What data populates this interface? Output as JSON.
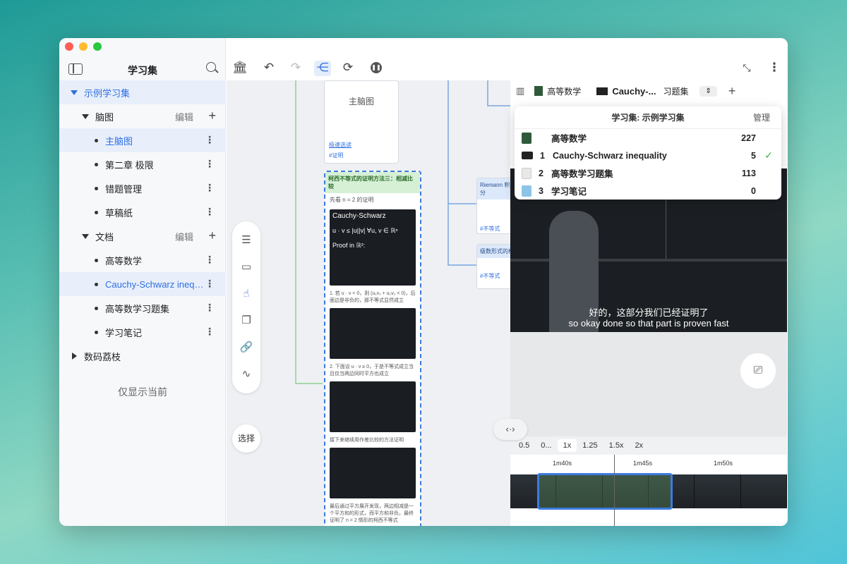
{
  "sidebar": {
    "title": "学习集",
    "root": "示例学习集",
    "mindmap": {
      "label": "脑图",
      "edit": "编辑",
      "items": [
        "主脑图",
        "第二章 极限",
        "错题管理",
        "草稿纸"
      ]
    },
    "docs": {
      "label": "文档",
      "edit": "编辑",
      "items": [
        "高等数学",
        "Cauchy-Schwarz inequ...",
        "高等数学习题集",
        "学习笔记"
      ]
    },
    "other": "数码荔枝",
    "show_current": "仅显示当前"
  },
  "toolbar": {
    "icons": [
      "library-icon",
      "undo-icon",
      "redo-icon",
      "mindmap-icon",
      "sync-icon",
      "pause-icon"
    ]
  },
  "canvas": {
    "node_main": "主脑图",
    "node_link": "极速选读",
    "node_tag": "#证明",
    "card_title": "柯西不等式的证明方法三：相减比较",
    "card_sub": "先看 n = 2 的证明",
    "card_math_title": "Cauchy-Schwarz",
    "card_math_1": "u · v ≤ |u||v|   ∀u, v ∈ ℝⁿ",
    "card_math_2": "Proof in ℝ²:",
    "card_text_1": "1. 若 u · v < 0，则 (u₁v₁ + u₂v₂ < 0)，后面边是非负的，那不等式显然成立",
    "card_text_2": "2. 下面设 u · v ≥ 0，于是不等式成立当且仅当两边同时平方也成立",
    "card_text_3": "接下来继续用作差比较的方法证明",
    "card_text_4": "最后通过平方展开发现，两边相减是一个平方和的形式，而平方和非负。最终证明了 n = 2 情形的柯西不等式",
    "riemann": "Riemann 积分",
    "riemann_tag": "#不等式",
    "series": "级数形式的柯",
    "series_tag": "#不等式",
    "choose": "选择"
  },
  "right": {
    "tabs": [
      "高等数学",
      "Cauchy-...",
      "习题集"
    ],
    "subtitle_zh": "好的，这部分我们已经证明了",
    "subtitle_en": "so okay done so that part is proven fast",
    "speeds": [
      "0.5",
      "0...",
      "1x",
      "1.25",
      "1.5x",
      "2x"
    ],
    "active_speed": "1x",
    "ticks": [
      "1m40s",
      "1m45s",
      "1m50s"
    ]
  },
  "popup": {
    "title": "学习集: 示例学习集",
    "manage": "管理",
    "rows": [
      {
        "num": "",
        "name": "高等数学",
        "count": "227",
        "check": ""
      },
      {
        "num": "1",
        "name": "Cauchy-Schwarz inequality",
        "count": "5",
        "check": "✓"
      },
      {
        "num": "2",
        "name": "高等数学习题集",
        "count": "113",
        "check": ""
      },
      {
        "num": "3",
        "name": "学习笔记",
        "count": "0",
        "check": ""
      }
    ]
  },
  "colors": {
    "accent": "#2f6fe0",
    "green": "#3bb34a",
    "selected_bg": "#e8effb"
  }
}
